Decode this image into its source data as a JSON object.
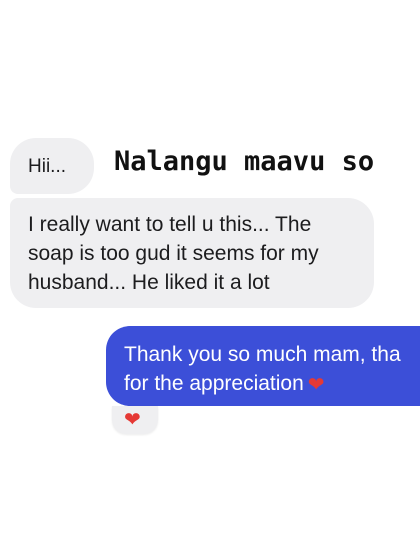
{
  "overlay": {
    "caption": "Nalangu maavu so"
  },
  "messages": [
    {
      "direction": "incoming",
      "text": "Hii..."
    },
    {
      "direction": "incoming",
      "lines": [
        "I really want to tell u this... The",
        "soap is too gud it seems for my",
        "husband... He liked it a lot"
      ]
    },
    {
      "direction": "outgoing",
      "lines": [
        "Thank you so much mam, tha",
        "for the appreciation"
      ],
      "emoji": "heart-icon"
    }
  ],
  "reaction": {
    "emoji": "heart-icon"
  },
  "colors": {
    "incoming_bubble": "#efeff1",
    "outgoing_bubble": "#3c4fd8",
    "heart": "#e53935"
  }
}
